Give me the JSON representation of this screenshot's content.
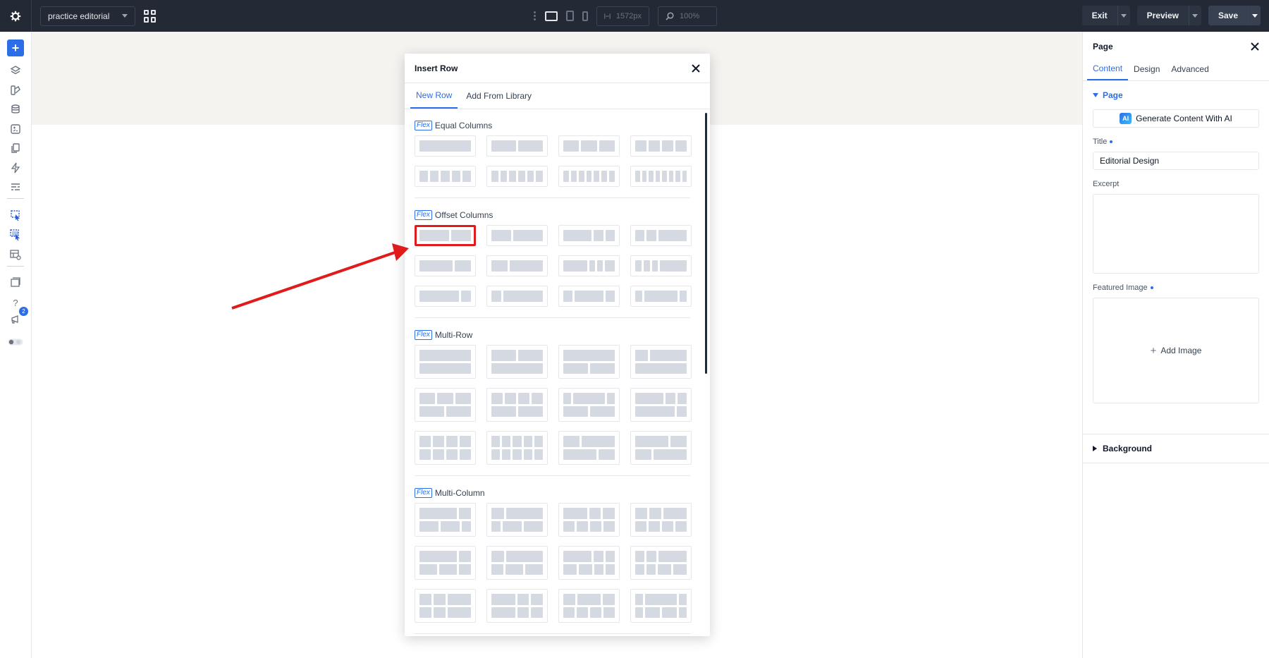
{
  "topbar": {
    "project_name": "practice editorial",
    "width_value": "1572px",
    "zoom_value": "100%",
    "exit_label": "Exit",
    "preview_label": "Preview",
    "save_label": "Save"
  },
  "leftbar": {
    "notification_count": "2"
  },
  "modal": {
    "title": "Insert Row",
    "tabs": [
      "New Row",
      "Add From Library"
    ],
    "flex_tag": "Flex",
    "sections": [
      "Equal Columns",
      "Offset Columns",
      "Multi-Row",
      "Multi-Column"
    ]
  },
  "panel": {
    "title": "Page",
    "tabs": [
      "Content",
      "Design",
      "Advanced"
    ],
    "group_page": "Page",
    "ai_logo": "AI",
    "ai_button": "Generate Content With AI",
    "title_label": "Title",
    "title_value": "Editorial Design",
    "excerpt_label": "Excerpt",
    "featured_label": "Featured Image",
    "add_image": "Add Image",
    "group_background": "Background"
  },
  "colors": {
    "accent": "#2b6ee8",
    "topbar_bg": "#232a36",
    "highlight": "#e01b1b",
    "tile_fill": "#d5d9e1"
  }
}
